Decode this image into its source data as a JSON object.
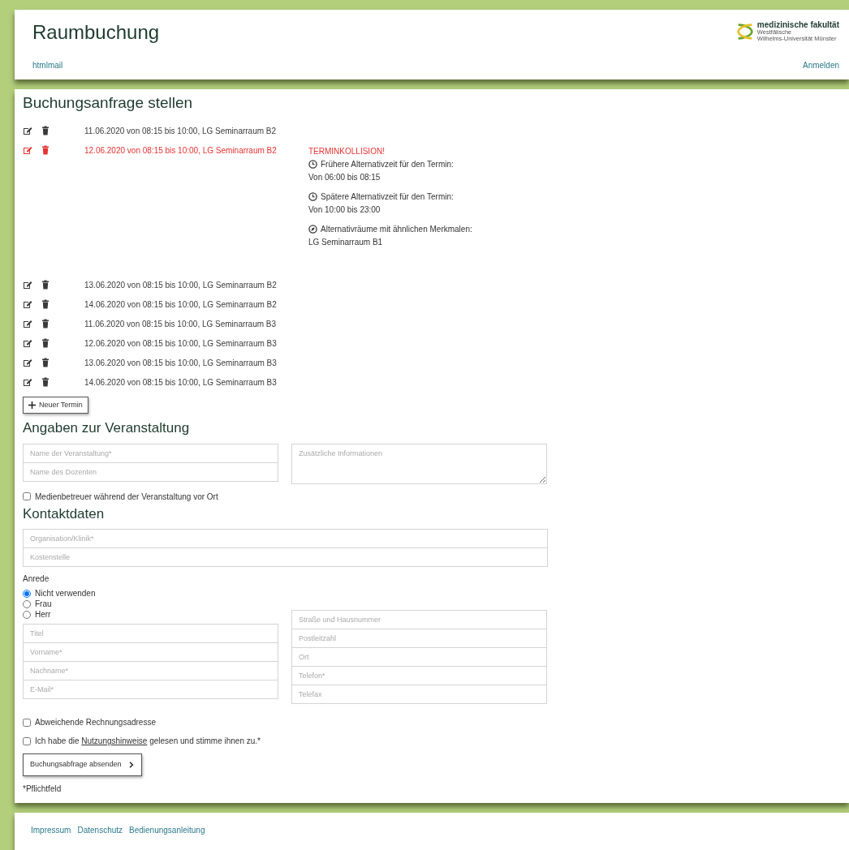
{
  "header": {
    "title": "Raumbuchung",
    "user_link": "htmlmail",
    "login_link": "Anmelden",
    "logo": {
      "name": "medizinische fakultät",
      "line1": "Westfälische",
      "line2": "Wilhelms-Universität Münster"
    }
  },
  "booking": {
    "heading": "Buchungsanfrage stellen",
    "appointments": [
      {
        "text": "11.06.2020 von 08:15 bis 10:00, LG Seminarraum B2",
        "conflict": false
      },
      {
        "text": "12.06.2020 von 08:15 bis 10:00, LG Seminarraum B2",
        "conflict": true,
        "conflict_title": "TERMINKOLLISION!",
        "alternatives": [
          {
            "kind": "clock",
            "label": "Frühere Alternativzeit für den Termin:",
            "value": "Von 06:00 bis 08:15"
          },
          {
            "kind": "clock",
            "label": "Spätere Alternativzeit für den Termin:",
            "value": "Von 10:00 bis 23:00"
          },
          {
            "kind": "room",
            "label": "Alternativräume mit ähnlichen Merkmalen:",
            "value": "LG Seminarraum B1"
          }
        ]
      },
      {
        "text": "13.06.2020 von 08:15 bis 10:00, LG Seminarraum B2",
        "conflict": false
      },
      {
        "text": "14.06.2020 von 08:15 bis 10:00, LG Seminarraum B2",
        "conflict": false
      },
      {
        "text": "11.06.2020 von 08:15 bis 10:00, LG Seminarraum B3",
        "conflict": false
      },
      {
        "text": "12.06.2020 von 08:15 bis 10:00, LG Seminarraum B3",
        "conflict": false
      },
      {
        "text": "13.06.2020 von 08:15 bis 10:00, LG Seminarraum B3",
        "conflict": false
      },
      {
        "text": "14.06.2020 von 08:15 bis 10:00, LG Seminarraum B3",
        "conflict": false
      }
    ],
    "new_button": "Neuer Termin"
  },
  "event": {
    "heading": "Angaben zur Veranstaltung",
    "fields": [
      {
        "placeholder": "Name der Veranstaltung*"
      },
      {
        "placeholder": "Name des Dozenten"
      }
    ],
    "textarea": {
      "placeholder": "Zusätzliche Informationen"
    },
    "media_checkbox": {
      "label": "Medienbetreuer während der Veranstaltung vor Ort",
      "checked": false
    }
  },
  "contact": {
    "heading": "Kontaktdaten",
    "fields": [
      {
        "placeholder": "Organisation/Klinik*"
      },
      {
        "placeholder": "Kostenstelle"
      }
    ],
    "salutation": {
      "label": "Anrede",
      "options": [
        {
          "label": "Nicht verwenden",
          "selected": true
        },
        {
          "label": "Frau",
          "selected": false
        },
        {
          "label": "Herr",
          "selected": false
        }
      ]
    },
    "left_fields": [
      {
        "placeholder": "Titel"
      },
      {
        "placeholder": "Vorname*"
      },
      {
        "placeholder": "Nachname*"
      },
      {
        "placeholder": "E-Mail*"
      }
    ],
    "right_fields": [
      {
        "placeholder": "Straße und Hausnummer"
      },
      {
        "placeholder": "Postleitzahl"
      },
      {
        "placeholder": "Ort"
      },
      {
        "placeholder": "Telefon*"
      },
      {
        "placeholder": "Telefax"
      }
    ],
    "billing_checkbox": {
      "label": "Abweichende Rechnungsadresse",
      "checked": false
    },
    "terms_checkbox": {
      "before": "Ich habe die",
      "link": "Nutzungshinweise",
      "after": "gelesen und stimme ihnen zu.*",
      "checked": false
    },
    "submit": "Buchungsabfrage absenden",
    "required_note": "*Pflichtfeld"
  },
  "footer": {
    "links": [
      "Impressum",
      "Datenschutz",
      "Bedienungsanleitung"
    ]
  }
}
